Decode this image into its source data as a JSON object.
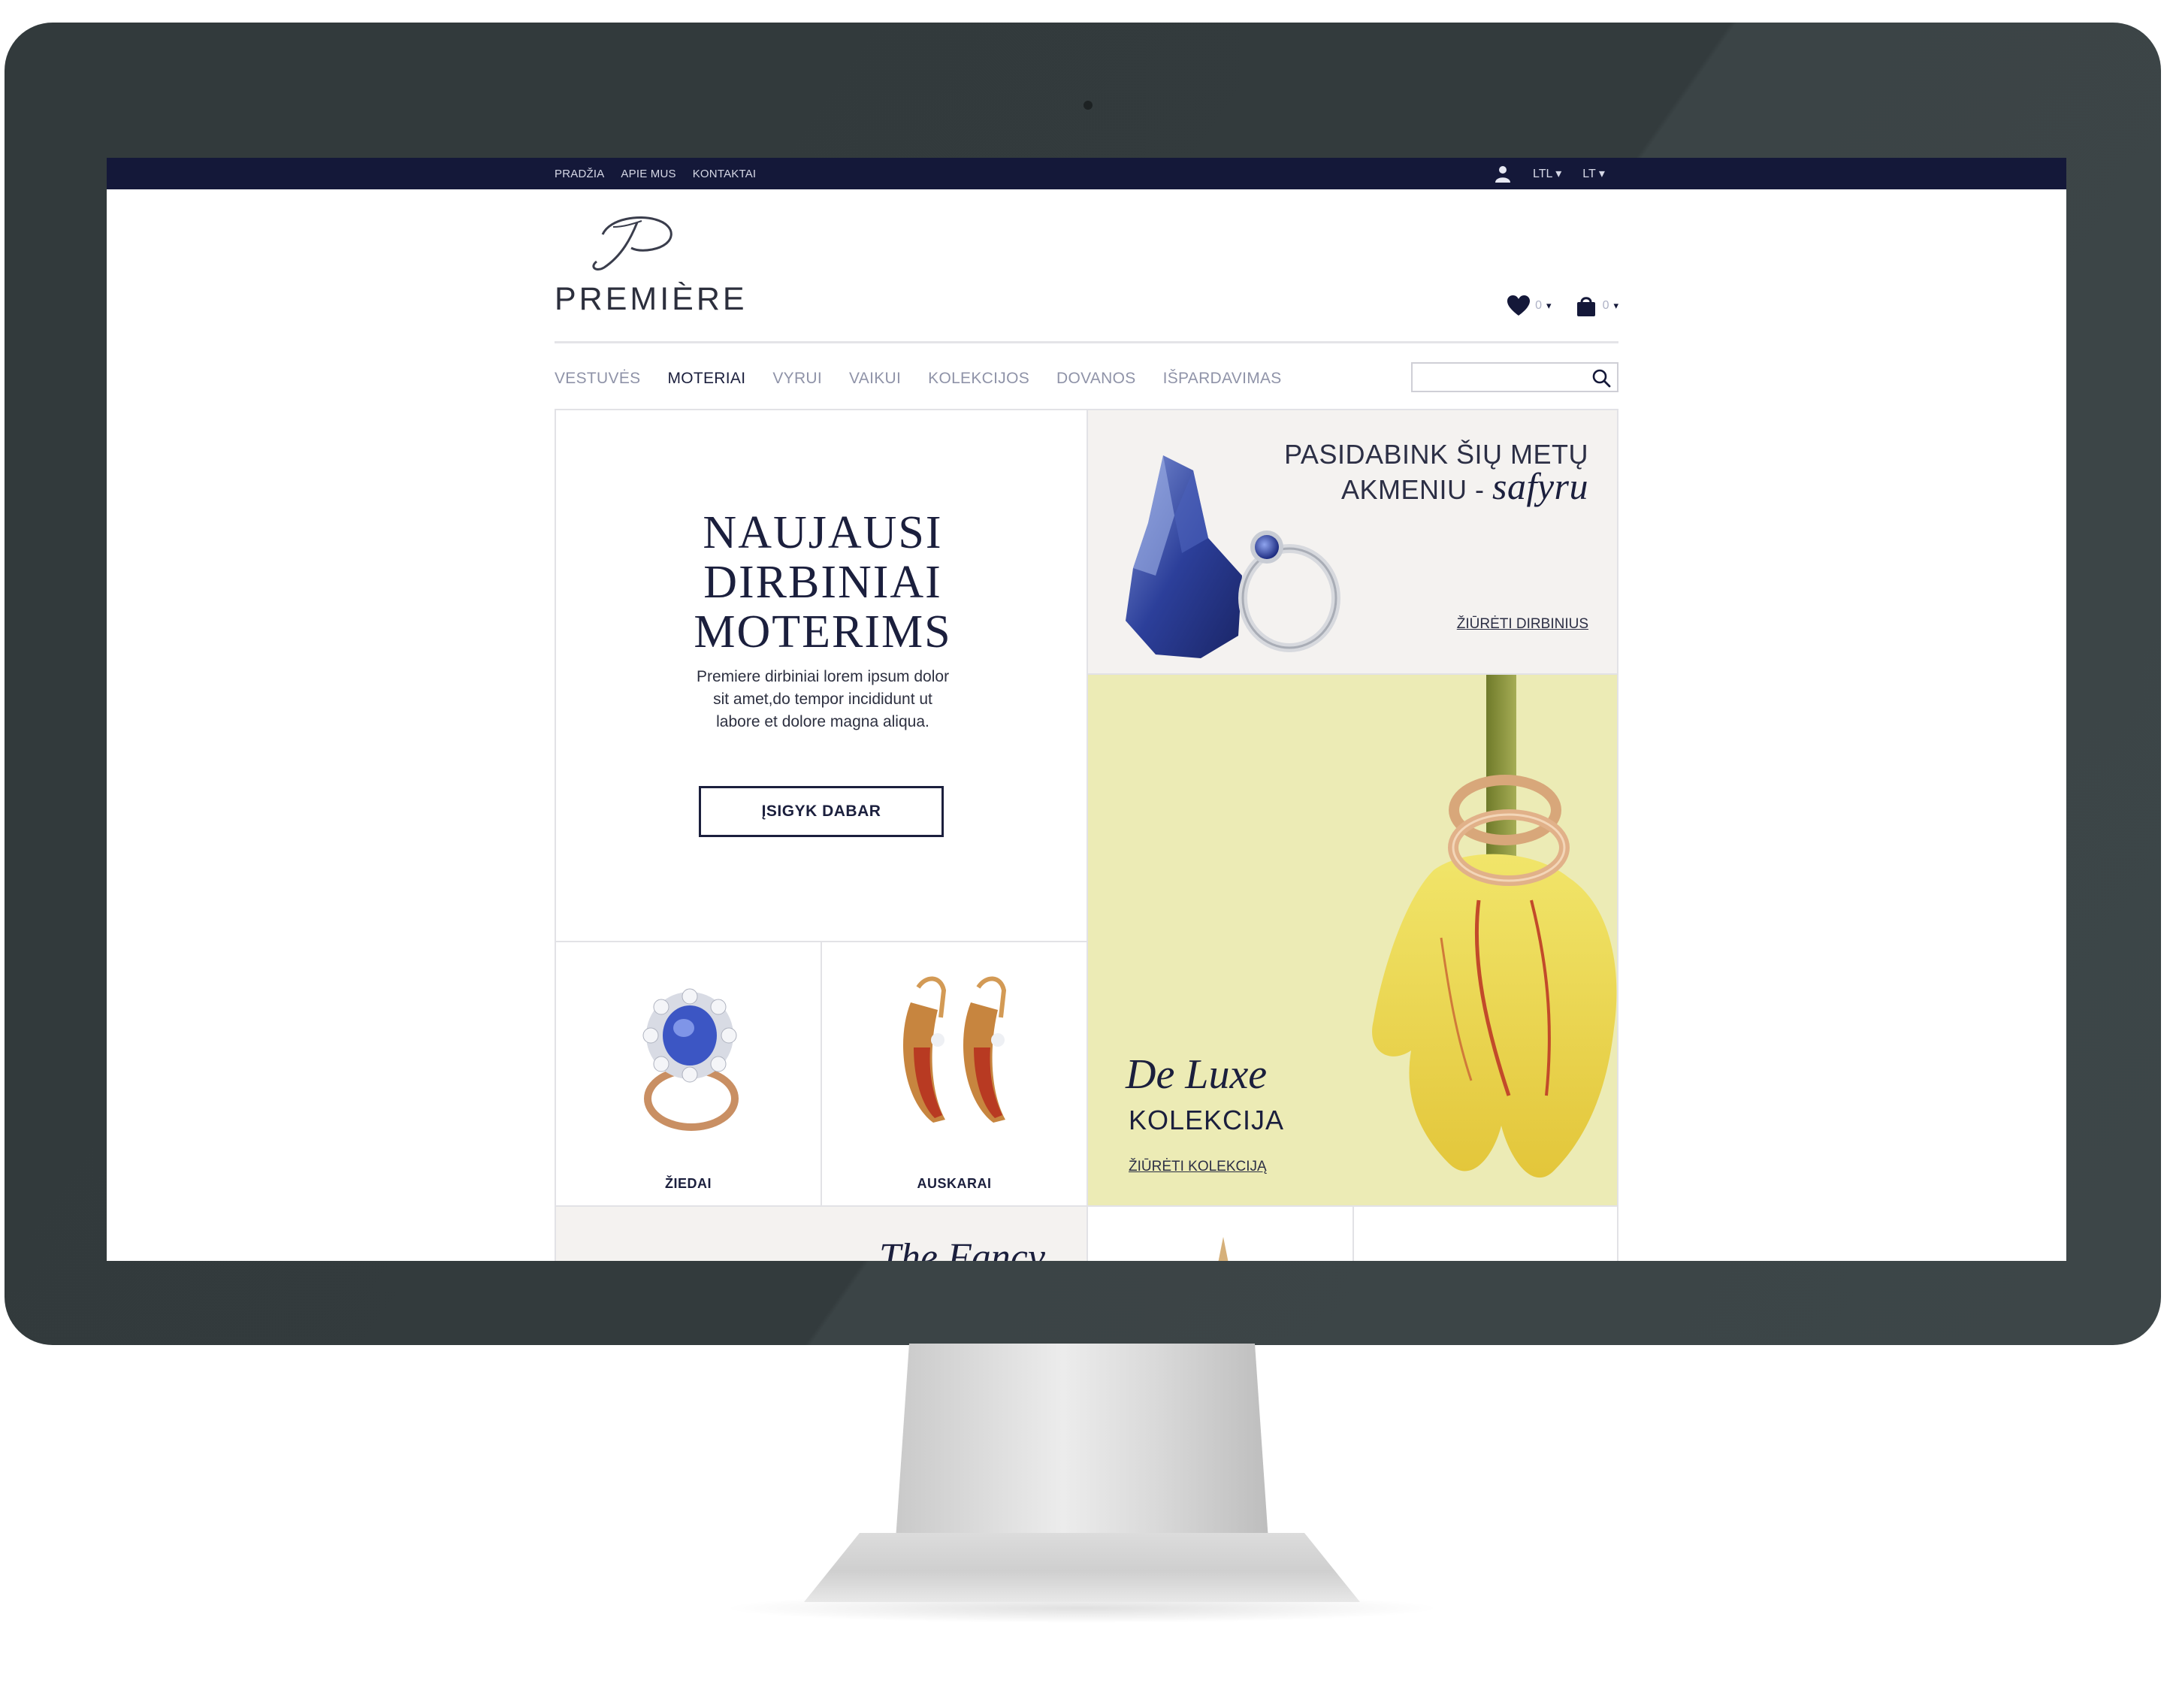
{
  "topbar": {
    "links": [
      "PRADŽIA",
      "APIE MUS",
      "KONTAKTAI"
    ],
    "currency": "LTL ▾",
    "language": "LT ▾"
  },
  "header": {
    "logo_text": "PREMIÈRE",
    "wishlist_count": "0",
    "cart_count": "0",
    "caret": "▾"
  },
  "nav": {
    "items": [
      "VESTUVĖS",
      "MOTERIAI",
      "VYRUI",
      "VAIKUI",
      "KOLEKCIJOS",
      "DOVANOS",
      "IŠPARDAVIMAS"
    ],
    "active": "MOTERIAI"
  },
  "search": {
    "placeholder": ""
  },
  "promo": {
    "title": "NAUJAUSI\nDIRBINIAI\nMOTERIMS",
    "text": "Premiere dirbiniai lorem ipsum dolor sit amet,do tempor incididunt ut labore et dolore magna aliqua.",
    "button": "ĮSIGYK DABAR"
  },
  "sapphire": {
    "line1": "PASIDABINK ŠIŲ METŲ",
    "line2": "AKMENIU -",
    "script": "safyru",
    "link": "ŽIŪRĖTI DIRBINIUS"
  },
  "deluxe": {
    "script": "De Luxe",
    "title": "KOLEKCIJA",
    "link": "ŽIŪRĖTI KOLEKCIJĄ"
  },
  "products": {
    "rings": "ŽIEDAI",
    "earrings": "AUSKARAI"
  },
  "fancy": {
    "title": "The Fancy"
  },
  "colors": {
    "navy": "#141839",
    "text_dark": "#1b1f3d",
    "sapphire_bg": "#f4f2f0",
    "deluxe_bg": "#ecebb5",
    "frame": "#333b3d"
  }
}
